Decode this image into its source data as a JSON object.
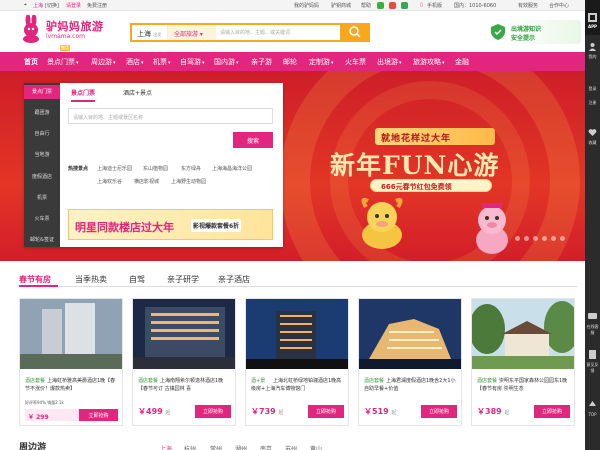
{
  "topbar": {
    "city": "上海",
    "switch": "[切换]",
    "login": "请登录",
    "register": "免费注册",
    "my": "我的驴妈妈",
    "mall": "驴钥商城",
    "help": "帮助",
    "mobile": "手机版",
    "domestic": "国内：1010-6060",
    "friend": "有效服务",
    "partner": "合作中心"
  },
  "brand": {
    "name_cn": "驴妈妈旅游",
    "name_en": "lvmama.com",
    "tag": "微信"
  },
  "search": {
    "city": "上海",
    "city_sub": "出发",
    "category": "全部旅游",
    "placeholder": "请输入目的地、主题、或关键词",
    "button_icon": "search-icon"
  },
  "promo": {
    "line1": "出境游知识",
    "line2": "安全提示"
  },
  "nav": {
    "items": [
      "首页",
      "景点门票",
      "周边游",
      "酒店",
      "机票",
      "自驾游",
      "国内游",
      "亲子游",
      "邮轮",
      "定制游",
      "火车票",
      "出境游",
      "旅游攻略",
      "金融"
    ]
  },
  "hero": {
    "badge": "就地花样过大年",
    "title": "新年FUN心游",
    "pill": "666元春节红包免费领"
  },
  "panel": {
    "side": [
      "景点门票",
      "跟团游",
      "自由行",
      "当地游",
      "度假酒店",
      "机票",
      "火车票",
      "邮轮&签证"
    ],
    "tabs": [
      "景点门票",
      "酒店+景点"
    ],
    "input_placeholder": "请输入目的地、主题或景区名称",
    "search_btn": "搜索",
    "hot_label": "热搜景点",
    "hot": [
      "上海迪士尼乐园",
      "东山植物园",
      "东方绿舟",
      "上海海昌海洋公园",
      "上海欢乐谷",
      "横店影视城",
      "上海野生动物园"
    ],
    "banner_text": "明星同款楼店过大年",
    "banner_sub": "影视爆款套餐6折"
  },
  "tabs": [
    "春节有房",
    "当季热卖",
    "自驾",
    "亲子研学",
    "亲子酒店"
  ],
  "cards": [
    {
      "tag": "酒店套餐",
      "title": "上海虹桥雅高美爵酒店1晚【春节不涨价！爆款热卖】",
      "note": "好评率94% 销量2.1k",
      "price": "￥ 299",
      "btn": "立即抢购"
    },
    {
      "tag": "酒店套餐",
      "title": "上海南翔希尔顿逸林酒店1晚【春节可订 古镇园林 喜",
      "price": "499",
      "price_unit": "起",
      "btn": "立即抢购"
    },
    {
      "tag": "酒+景",
      "title": "上海北虹桥绿地铂骊酒店1晚高级房+上海汽车博物馆门",
      "price": "739",
      "price_unit": "起",
      "btn": "立即抢购"
    },
    {
      "tag": "酒店套餐",
      "title": "上海君澜度假酒店1晚含2大1小自助早餐+价值",
      "price": "519",
      "price_unit": "起",
      "btn": "立即抢购"
    },
    {
      "tag": "酒店套餐",
      "title": "崇明东平国家森林公园园东1晚【春节有房 崇明生态",
      "price": "389",
      "price_unit": "起",
      "btn": "立即抢购"
    }
  ],
  "bottom": {
    "title": "周边游",
    "cities": [
      "上海",
      "杭州",
      "常州",
      "湖州",
      "南京",
      "苏州",
      "黄山"
    ]
  },
  "rail": {
    "app": "APP",
    "items": [
      "我的",
      "登录",
      "注册",
      "收藏",
      "在线客服",
      "意见反馈",
      "TOP"
    ]
  },
  "colors": {
    "brand": "#e2267f",
    "accent": "#f8a81c",
    "hero": "#d31e29"
  }
}
